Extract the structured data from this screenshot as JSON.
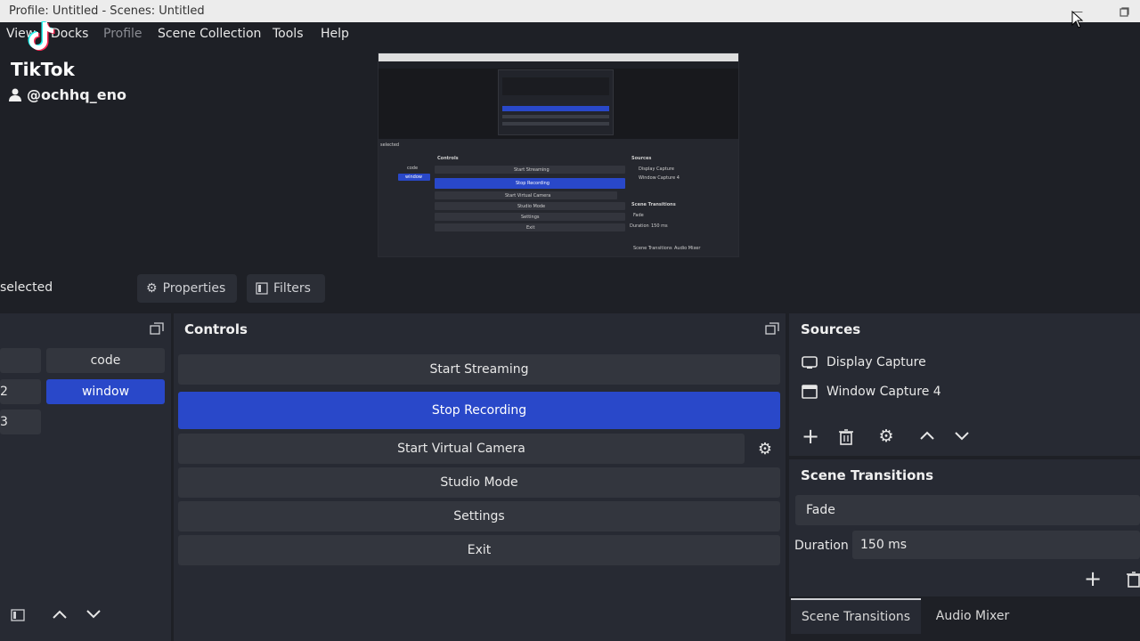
{
  "window": {
    "title": "Profile: Untitled - Scenes: Untitled"
  },
  "menu": {
    "view": "View",
    "docks": "Docks",
    "profile": "Profile",
    "scene_collection": "Scene Collection",
    "tools": "Tools",
    "help": "Help"
  },
  "overlay": {
    "brand": "TikTok",
    "username": "@ochhq_eno"
  },
  "preview": {
    "controls": "Controls",
    "start_streaming": "Start Streaming",
    "stop_recording": "Stop Recording",
    "start_virtual_camera": "Start Virtual Camera",
    "studio_mode": "Studio Mode",
    "settings": "Settings",
    "exit": "Exit",
    "sources": "Sources",
    "display_capture": "Display Capture",
    "window_capture": "Window Capture 4",
    "scene_transitions": "Scene Transitions",
    "fade": "Fade",
    "duration": "Duration",
    "duration_value": "150 ms",
    "tab_transitions": "Scene Transitions",
    "tab_mixer": "Audio Mixer",
    "selected": "selected",
    "scene_code": "code",
    "scene_window": "window"
  },
  "source_toolbar": {
    "selection": "selected",
    "properties": "Properties",
    "filters": "Filters"
  },
  "scenes": {
    "items": [
      {
        "num": "",
        "label": "code"
      },
      {
        "num": "2",
        "label": "window"
      },
      {
        "num": "3",
        "label": ""
      }
    ],
    "active_index": 1
  },
  "controls": {
    "title": "Controls",
    "start_streaming": "Start Streaming",
    "stop_recording": "Stop Recording",
    "start_virtual_camera": "Start Virtual Camera",
    "studio_mode": "Studio Mode",
    "settings": "Settings",
    "exit": "Exit"
  },
  "sources": {
    "title": "Sources",
    "items": [
      {
        "label": "Display Capture",
        "icon": "monitor-icon"
      },
      {
        "label": "Window Capture 4",
        "icon": "window-icon"
      }
    ]
  },
  "transitions": {
    "title": "Scene Transitions",
    "selected": "Fade",
    "duration_label": "Duration",
    "duration_value": "150 ms"
  },
  "tabs": {
    "scene_transitions": "Scene Transitions",
    "audio_mixer": "Audio Mixer"
  },
  "colors": {
    "accent": "#2948c9",
    "panel": "#272a33",
    "background": "#1e2026"
  }
}
